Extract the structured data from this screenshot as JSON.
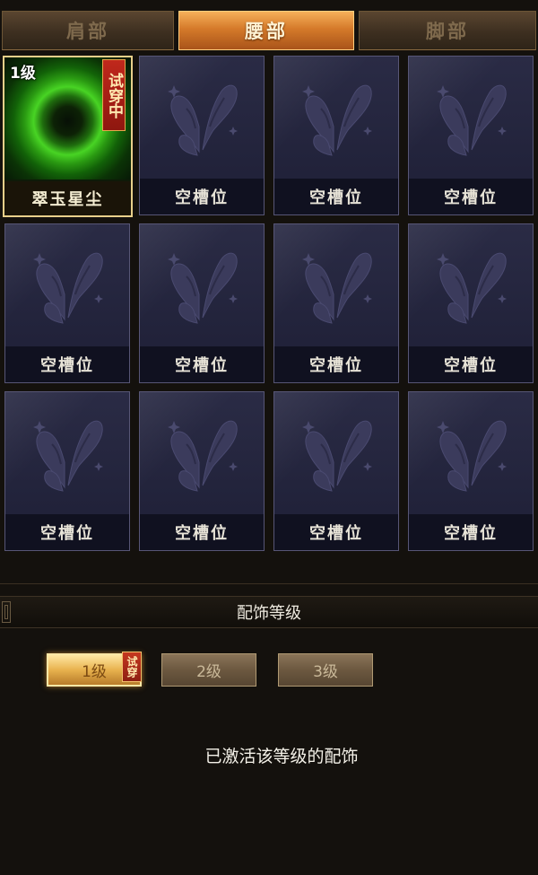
{
  "tabs": [
    {
      "label": "肩部",
      "active": false
    },
    {
      "label": "腰部",
      "active": true
    },
    {
      "label": "脚部",
      "active": false
    }
  ],
  "slots": [
    {
      "name": "翠玉星尘",
      "level": "1级",
      "tag": "试穿中",
      "equipped": true
    },
    {
      "name": "空槽位",
      "icon": "butterfly-icon"
    },
    {
      "name": "空槽位",
      "icon": "butterfly-icon"
    },
    {
      "name": "空槽位",
      "icon": "butterfly-icon"
    },
    {
      "name": "空槽位",
      "icon": "butterfly-icon"
    },
    {
      "name": "空槽位",
      "icon": "butterfly-icon"
    },
    {
      "name": "空槽位",
      "icon": "butterfly-icon"
    },
    {
      "name": "空槽位",
      "icon": "butterfly-icon"
    },
    {
      "name": "空槽位",
      "icon": "butterfly-icon"
    },
    {
      "name": "空槽位",
      "icon": "butterfly-icon"
    },
    {
      "name": "空槽位",
      "icon": "butterfly-icon"
    },
    {
      "name": "空槽位",
      "icon": "butterfly-icon"
    }
  ],
  "section": {
    "title": "配饰等级"
  },
  "levels": [
    {
      "label": "1级",
      "tag": "试穿",
      "active": true
    },
    {
      "label": "2级",
      "active": false
    },
    {
      "label": "3级",
      "active": false
    }
  ],
  "status": "已激活该等级的配饰",
  "colors": {
    "accent_orange": "#d57a2a",
    "glow_green": "#48d424",
    "slot_bg": "#25263f",
    "try_red": "#b0241a"
  }
}
